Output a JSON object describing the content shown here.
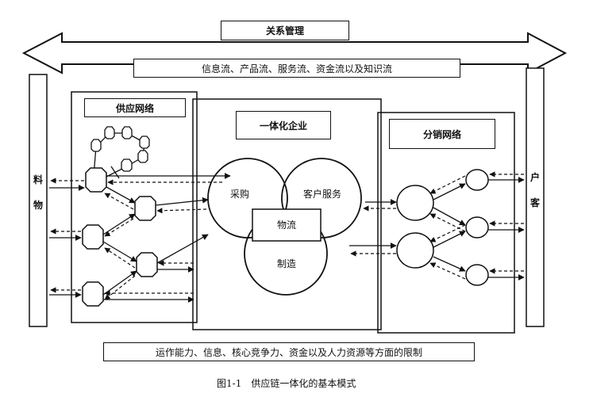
{
  "relationship_management": "关系管理",
  "flows_banner": "信息流、产品流、服务流、资金流以及知识流",
  "supply_network": "供应网络",
  "integrated_enterprise": "一体化企业",
  "distribution_network": "分销网络",
  "procurement": "采购",
  "customer_service": "客户服务",
  "logistics": "物流",
  "manufacturing": "制造",
  "materials_left": "物",
  "materials_right": "料",
  "customer_top": "客",
  "customer_bottom": "户",
  "constraints_banner": "运作能力、信息、核心竞争力、资金以及人力资源等方面的限制",
  "caption": "图1-1　供应链一体化的基本模式"
}
